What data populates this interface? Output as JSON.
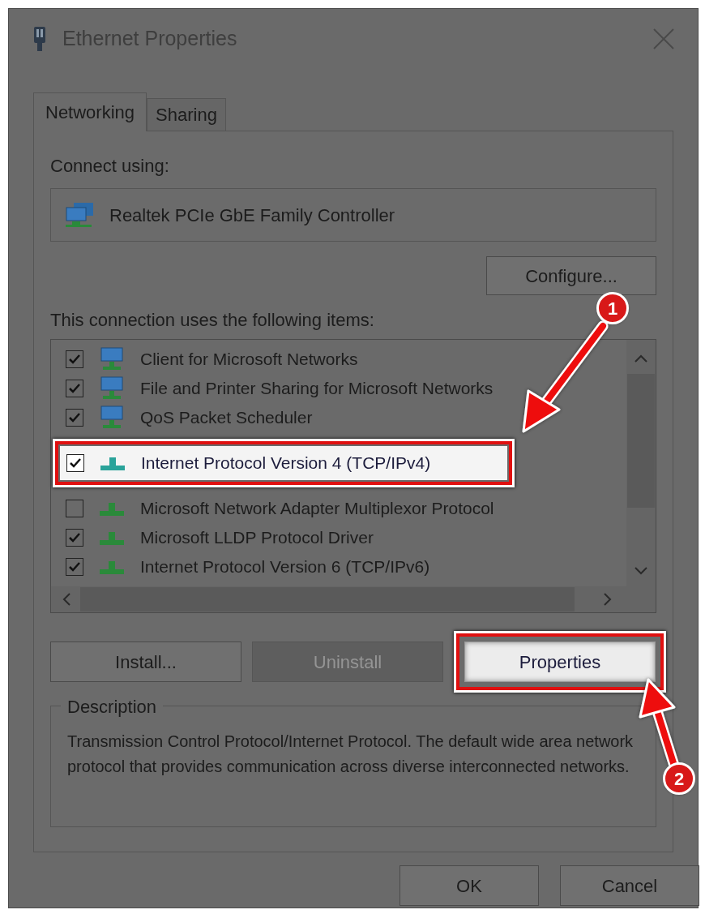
{
  "window": {
    "title": "Ethernet Properties"
  },
  "tabs": [
    {
      "label": "Networking",
      "selected": true
    },
    {
      "label": "Sharing",
      "selected": false
    }
  ],
  "connect_using": {
    "label": "Connect using:",
    "adapter": "Realtek PCIe GbE Family Controller"
  },
  "configure_button": "Configure...",
  "items_label": "This connection uses the following items:",
  "items": [
    {
      "kind": "service",
      "label": "Client for Microsoft Networks",
      "checked": true,
      "selected": false
    },
    {
      "kind": "service",
      "label": "File and Printer Sharing for Microsoft Networks",
      "checked": true,
      "selected": false
    },
    {
      "kind": "service",
      "label": "QoS Packet Scheduler",
      "checked": true,
      "selected": false
    },
    {
      "kind": "protocol",
      "label": "Internet Protocol Version 4 (TCP/IPv4)",
      "checked": true,
      "selected": true
    },
    {
      "kind": "protocol",
      "label": "Microsoft Network Adapter Multiplexor Protocol",
      "checked": false,
      "selected": false
    },
    {
      "kind": "protocol",
      "label": "Microsoft LLDP Protocol Driver",
      "checked": true,
      "selected": false
    },
    {
      "kind": "protocol",
      "label": "Internet Protocol Version 6 (TCP/IPv6)",
      "checked": true,
      "selected": false
    }
  ],
  "item_buttons": [
    {
      "label": "Install...",
      "disabled": false,
      "highlighted": false
    },
    {
      "label": "Uninstall",
      "disabled": true,
      "highlighted": false
    },
    {
      "label": "Properties",
      "disabled": false,
      "highlighted": true
    }
  ],
  "description": {
    "title": "Description",
    "text": "Transmission Control Protocol/Internet Protocol. The default wide area network protocol that provides communication across diverse interconnected networks."
  },
  "dialog_buttons": [
    "OK",
    "Cancel"
  ],
  "annotations": [
    {
      "label": "1"
    },
    {
      "label": "2"
    }
  ]
}
